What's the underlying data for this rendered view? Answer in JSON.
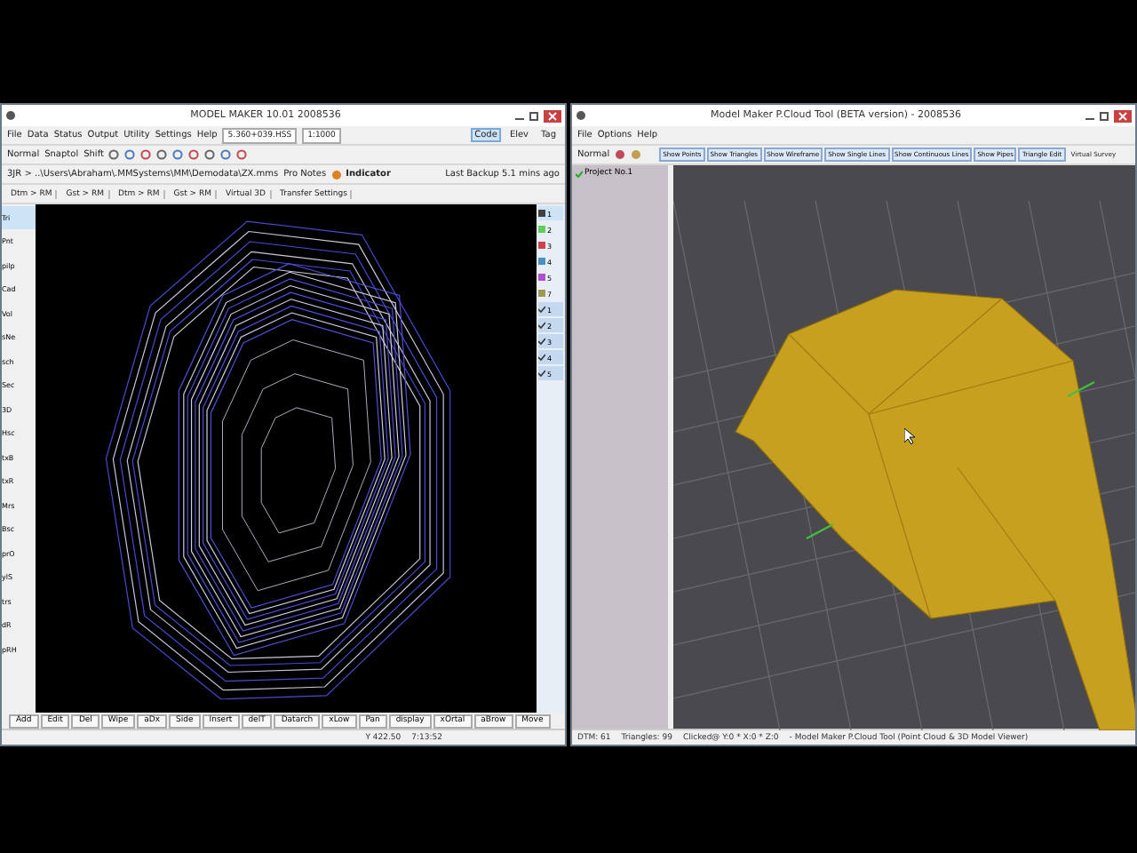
{
  "left_window": {
    "title": "MODEL MAKER  10.01    2008536",
    "menu": [
      "File",
      "Data",
      "Status",
      "Output",
      "Utility",
      "Settings",
      "Help"
    ],
    "coord_field": "5.360+039.HSS",
    "scale_field": "1:1000",
    "mode_buttons": [
      {
        "label": "Code",
        "selected": true
      },
      {
        "label": "Elev",
        "selected": false
      },
      {
        "label": "Tag",
        "selected": false
      }
    ],
    "tools": [
      "Normal",
      "Snaptol",
      "Shift"
    ],
    "path": "3JR > ..\\Users\\Abraham\\.MMSystems\\MM\\Demodata\\ZX.mms",
    "notes": "Pro Notes",
    "indicator": "Indicator",
    "backup": "Last Backup 5.1 mins ago",
    "tabs": [
      {
        "label": "Dtm > RM",
        "selected": false
      },
      {
        "label": "Gst > RM",
        "selected": false
      },
      {
        "label": "Dtm > RM",
        "selected": false
      },
      {
        "label": "Gst > RM",
        "selected": false
      },
      {
        "label": "Virtual 3D",
        "selected": false
      },
      {
        "label": "Transfer Settings",
        "selected": false
      }
    ],
    "side_tools": [
      {
        "label": "Tri",
        "selected": true
      },
      {
        "label": "Pnt",
        "selected": false
      },
      {
        "label": "pilp",
        "selected": false
      },
      {
        "label": "Cad",
        "selected": false
      },
      {
        "label": "Vol",
        "selected": false
      },
      {
        "label": "sNe",
        "selected": false
      },
      {
        "label": "sch",
        "selected": false
      },
      {
        "label": "Sec",
        "selected": false
      },
      {
        "label": "3D",
        "selected": false
      },
      {
        "label": "Hsc",
        "selected": false
      },
      {
        "label": "txB",
        "selected": false
      },
      {
        "label": "txR",
        "selected": false
      },
      {
        "label": "Mrs",
        "selected": false
      },
      {
        "label": "Bsc",
        "selected": false
      },
      {
        "label": "prO",
        "selected": false
      },
      {
        "label": "ylS",
        "selected": false
      },
      {
        "label": "trs",
        "selected": false
      },
      {
        "label": "dR",
        "selected": false
      },
      {
        "label": "pRH",
        "selected": false
      }
    ],
    "layers": [
      {
        "label": "1",
        "color": "#404040",
        "selected": true
      },
      {
        "label": "2",
        "color": "#5ad05a",
        "selected": false
      },
      {
        "label": "3",
        "color": "#d04050",
        "selected": false
      },
      {
        "label": "4",
        "color": "#4a90c8",
        "selected": false
      },
      {
        "label": "5",
        "color": "#b050d0",
        "selected": false
      },
      {
        "label": "7",
        "color": "#a09a50",
        "selected": false
      }
    ],
    "checks": [
      {
        "label": "1",
        "checked": true
      },
      {
        "label": "2",
        "checked": true
      },
      {
        "label": "3",
        "checked": true
      },
      {
        "label": "4",
        "checked": true
      },
      {
        "label": "5",
        "checked": true
      }
    ],
    "bottom_buttons": [
      "Add",
      "Edit",
      "Del",
      "Wipe",
      "aDx",
      "Side",
      "Insert",
      "delT",
      "Datarch",
      "xLow",
      "Pan",
      "display",
      "xOrtal",
      "aBrow",
      "Move"
    ],
    "status": [
      "Y 422.50",
      "7:13:52"
    ]
  },
  "right_window": {
    "title": "Model Maker P.Cloud Tool (BETA version) - 2008536",
    "menu": [
      "File",
      "Options",
      "Help"
    ],
    "mode": "Normal",
    "view_buttons": [
      "Show Points",
      "Show Triangles",
      "Show Wireframe",
      "Show Single Lines",
      "Show Continuous Lines",
      "Show Pipes",
      "Triangle Edit"
    ],
    "extra": "Virtual Survey",
    "tree": [
      {
        "label": "Project No.1",
        "checked": true
      }
    ],
    "status": [
      "DTM: 61",
      "Triangles: 99",
      "Clicked@ Y:0 * X:0 * Z:0",
      "- Model Maker P.Cloud Tool (Point Cloud & 3D Model Viewer)"
    ]
  }
}
